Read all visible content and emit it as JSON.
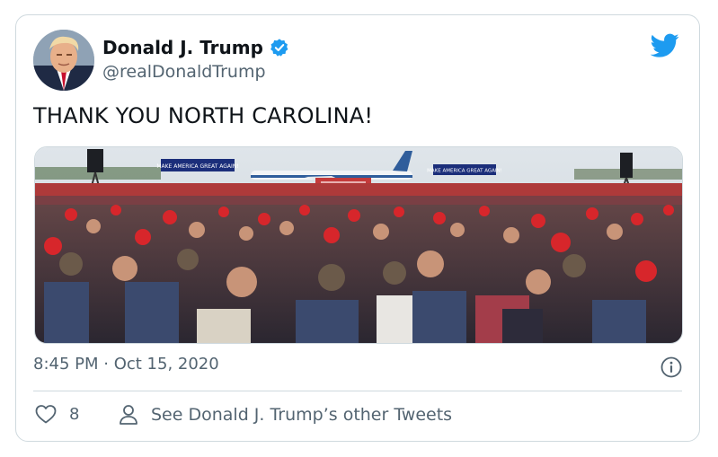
{
  "tweet": {
    "author": {
      "display_name": "Donald J. Trump",
      "handle": "@realDonaldTrump",
      "verified": true
    },
    "text": "THANK YOU NORTH CAROLINA!",
    "media": {
      "banner_texts": [
        "MAKE AMERICA GREAT AGAIN!",
        "MAKE AMERICA GREAT AGAIN!"
      ]
    },
    "timestamp": "8:45 PM · Oct 15, 2020",
    "likes": "8",
    "other_tweets_label": "See Donald J. Trump’s other Tweets"
  },
  "icons": {
    "brand": "twitter-bird-icon",
    "verified": "verified-badge-icon",
    "info": "info-icon",
    "like": "heart-icon",
    "profile": "person-icon"
  },
  "colors": {
    "brand_blue": "#1d9bf0",
    "text_primary": "#0f1419",
    "text_secondary": "#536471",
    "border": "#cfd9de"
  }
}
